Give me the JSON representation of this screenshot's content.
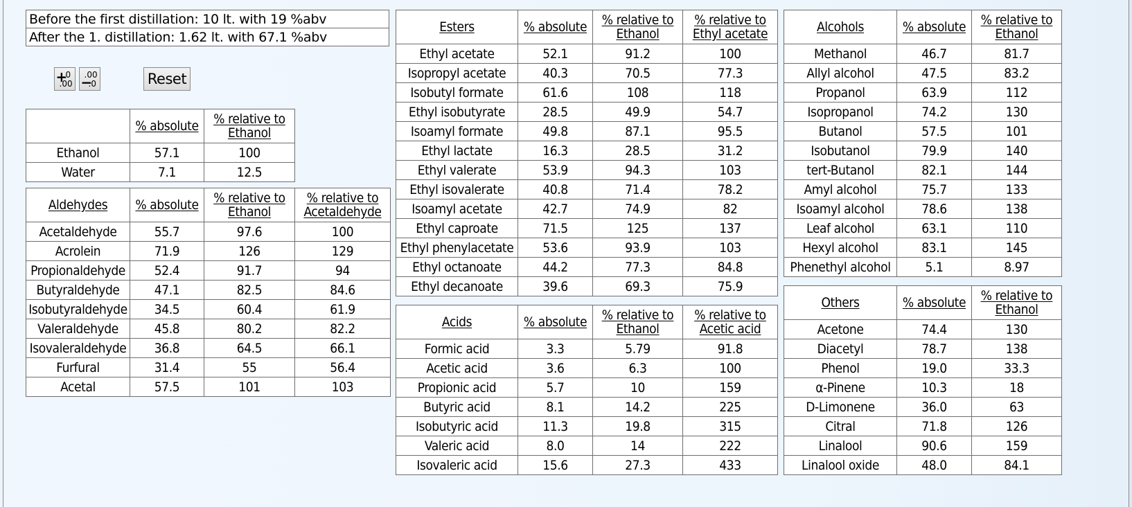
{
  "summary": {
    "before": "Before the first distillation: 10 lt. with 19 %abv",
    "after": "After the 1. distillation: 1.62 lt. with 67.1 %abv"
  },
  "controls": {
    "increase_decimals": {
      "icon": "increase-decimals-icon",
      "plus": "+",
      "top": "0",
      "bottom": ".00"
    },
    "decrease_decimals": {
      "icon": "decrease-decimals-icon",
      "minus": "−",
      "top": ".00",
      "bottom": ".0"
    },
    "reset_label": "Reset"
  },
  "ethanol_table": {
    "headers": [
      "",
      "% absolute",
      "% relative to Ethanol"
    ],
    "rows": [
      [
        "Ethanol",
        "57.1",
        "100"
      ],
      [
        "Water",
        "7.1",
        "12.5"
      ]
    ]
  },
  "aldehydes_table": {
    "headers": [
      "Aldehydes",
      "% absolute",
      "% relative to Ethanol",
      "% relative to Acetaldehyde"
    ],
    "rows": [
      [
        "Acetaldehyde",
        "55.7",
        "97.6",
        "100"
      ],
      [
        "Acrolein",
        "71.9",
        "126",
        "129"
      ],
      [
        "Propionaldehyde",
        "52.4",
        "91.7",
        "94"
      ],
      [
        "Butyraldehyde",
        "47.1",
        "82.5",
        "84.6"
      ],
      [
        "Isobutyraldehyde",
        "34.5",
        "60.4",
        "61.9"
      ],
      [
        "Valeraldehyde",
        "45.8",
        "80.2",
        "82.2"
      ],
      [
        "Isovaleraldehyde",
        "36.8",
        "64.5",
        "66.1"
      ],
      [
        "Furfural",
        "31.4",
        "55",
        "56.4"
      ],
      [
        "Acetal",
        "57.5",
        "101",
        "103"
      ]
    ]
  },
  "esters_table": {
    "headers": [
      "Esters",
      "% absolute",
      "% relative to Ethanol",
      "% relative to Ethyl acetate"
    ],
    "rows": [
      [
        "Ethyl acetate",
        "52.1",
        "91.2",
        "100"
      ],
      [
        "Isopropyl acetate",
        "40.3",
        "70.5",
        "77.3"
      ],
      [
        "Isobutyl formate",
        "61.6",
        "108",
        "118"
      ],
      [
        "Ethyl isobutyrate",
        "28.5",
        "49.9",
        "54.7"
      ],
      [
        "Isoamyl formate",
        "49.8",
        "87.1",
        "95.5"
      ],
      [
        "Ethyl lactate",
        "16.3",
        "28.5",
        "31.2"
      ],
      [
        "Ethyl valerate",
        "53.9",
        "94.3",
        "103"
      ],
      [
        "Ethyl isovalerate",
        "40.8",
        "71.4",
        "78.2"
      ],
      [
        "Isoamyl acetate",
        "42.7",
        "74.9",
        "82"
      ],
      [
        "Ethyl caproate",
        "71.5",
        "125",
        "137"
      ],
      [
        "Ethyl phenylacetate",
        "53.6",
        "93.9",
        "103"
      ],
      [
        "Ethyl octanoate",
        "44.2",
        "77.3",
        "84.8"
      ],
      [
        "Ethyl decanoate",
        "39.6",
        "69.3",
        "75.9"
      ]
    ]
  },
  "acids_table": {
    "headers": [
      "Acids",
      "% absolute",
      "% relative to Ethanol",
      "% relative to Acetic acid"
    ],
    "rows": [
      [
        "Formic acid",
        "3.3",
        "5.79",
        "91.8"
      ],
      [
        "Acetic acid",
        "3.6",
        "6.3",
        "100"
      ],
      [
        "Propionic acid",
        "5.7",
        "10",
        "159"
      ],
      [
        "Butyric acid",
        "8.1",
        "14.2",
        "225"
      ],
      [
        "Isobutyric acid",
        "11.3",
        "19.8",
        "315"
      ],
      [
        "Valeric acid",
        "8.0",
        "14",
        "222"
      ],
      [
        "Isovaleric acid",
        "15.6",
        "27.3",
        "433"
      ]
    ]
  },
  "alcohols_table": {
    "headers": [
      "Alcohols",
      "% absolute",
      "% relative to Ethanol"
    ],
    "rows": [
      [
        "Methanol",
        "46.7",
        "81.7"
      ],
      [
        "Allyl alcohol",
        "47.5",
        "83.2"
      ],
      [
        "Propanol",
        "63.9",
        "112"
      ],
      [
        "Isopropanol",
        "74.2",
        "130"
      ],
      [
        "Butanol",
        "57.5",
        "101"
      ],
      [
        "Isobutanol",
        "79.9",
        "140"
      ],
      [
        "tert-Butanol",
        "82.1",
        "144"
      ],
      [
        "Amyl alcohol",
        "75.7",
        "133"
      ],
      [
        "Isoamyl alcohol",
        "78.6",
        "138"
      ],
      [
        "Leaf alcohol",
        "63.1",
        "110"
      ],
      [
        "Hexyl alcohol",
        "83.1",
        "145"
      ],
      [
        "Phenethyl alcohol",
        "5.1",
        "8.97"
      ]
    ]
  },
  "others_table": {
    "headers": [
      "Others",
      "% absolute",
      "% relative to Ethanol"
    ],
    "rows": [
      [
        "Acetone",
        "74.4",
        "130"
      ],
      [
        "Diacetyl",
        "78.7",
        "138"
      ],
      [
        "Phenol",
        "19.0",
        "33.3"
      ],
      [
        "α-Pinene",
        "10.3",
        "18"
      ],
      [
        "D-Limonene",
        "36.0",
        "63"
      ],
      [
        "Citral",
        "71.8",
        "126"
      ],
      [
        "Linalool",
        "90.6",
        "159"
      ],
      [
        "Linalool oxide",
        "48.0",
        "84.1"
      ]
    ]
  }
}
